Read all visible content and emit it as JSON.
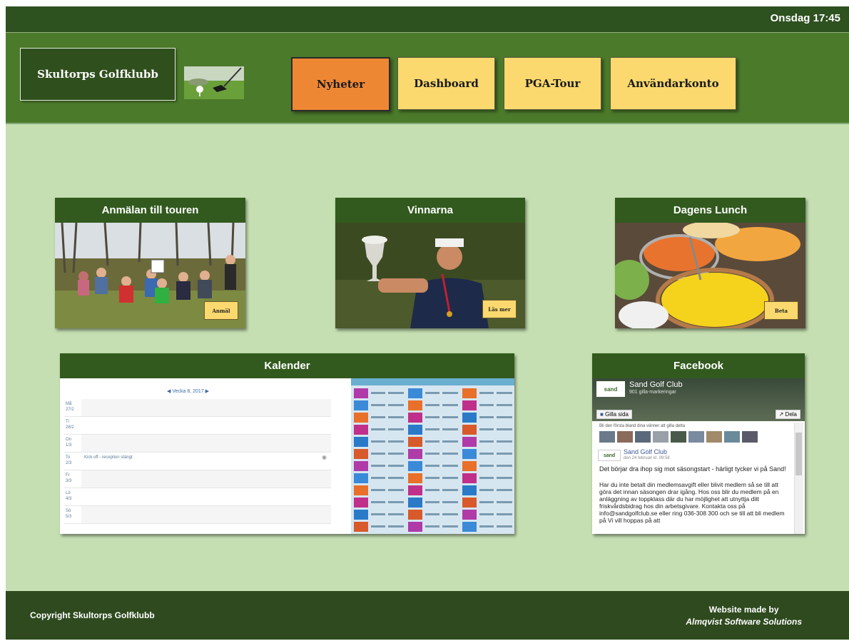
{
  "topbar": {
    "clock": "Onsdag 17:45"
  },
  "header": {
    "logo_text": "Skultorps Golfklubb"
  },
  "nav": [
    {
      "label": "Nyheter",
      "active": true
    },
    {
      "label": "Dashboard",
      "active": false
    },
    {
      "label": "PGA-Tour",
      "active": false
    },
    {
      "label": "Användarkonto",
      "active": false
    }
  ],
  "cards": {
    "anmalan": {
      "title": "Anmälan till touren",
      "button": "Anmäl"
    },
    "vinnarna": {
      "title": "Vinnarna",
      "button": "Läs mer"
    },
    "lunch": {
      "title": "Dagens Lunch",
      "button": "Beta"
    },
    "kalender": {
      "title": "Kalender",
      "week_label": "Vecka 8, 2017",
      "days": [
        {
          "day": "Må",
          "date": "27/2",
          "event": ""
        },
        {
          "day": "Ti",
          "date": "28/2",
          "event": ""
        },
        {
          "day": "On",
          "date": "1/3",
          "event": ""
        },
        {
          "day": "To",
          "date": "2/3",
          "event": "Kick off - reception stängt"
        },
        {
          "day": "Fr",
          "date": "3/3",
          "event": ""
        },
        {
          "day": "Lö",
          "date": "4/3",
          "event": ""
        },
        {
          "day": "Sö",
          "date": "5/3",
          "event": ""
        }
      ]
    },
    "facebook": {
      "title": "Facebook",
      "page_name": "Sand Golf Club",
      "likes": "901 gilla-markeringar",
      "like_button": "Gilla sida",
      "share_button": "Dela",
      "friends_text": "Bli den första bland dina vänner att gilla detta",
      "post_author": "Sand Golf Club",
      "post_date": "den 24 februari kl. 09:58",
      "post_line1": "Det börjar dra ihop sig mot säsongstart - härligt tycker vi på Sand!",
      "post_line2": "Har du inte betalt din medlemsavgift eller blivit medlem så se till att göra det innan säsongen drar igång. Hos oss blir du medlem på en anläggning av toppklass där du har möjlighet att utnyttja ditt friskvårdsbidrag hos din arbetsgivare. Kontakta oss på info@sandgolfclub.se eller ring 036-308 300 och se till att bli medlem på Vi vill hoppas på att"
    }
  },
  "footer": {
    "copyright": "Copyright Skultorps Golfklubb",
    "madeby_line1": "Website made by",
    "madeby_line2": "Almqvist Software Solutions"
  },
  "colors": {
    "background": "#c5dfb2",
    "dark_green": "#2e5120",
    "header_green": "#4b7a2b",
    "button_yellow": "#fbd96e",
    "button_orange": "#ee8734"
  }
}
